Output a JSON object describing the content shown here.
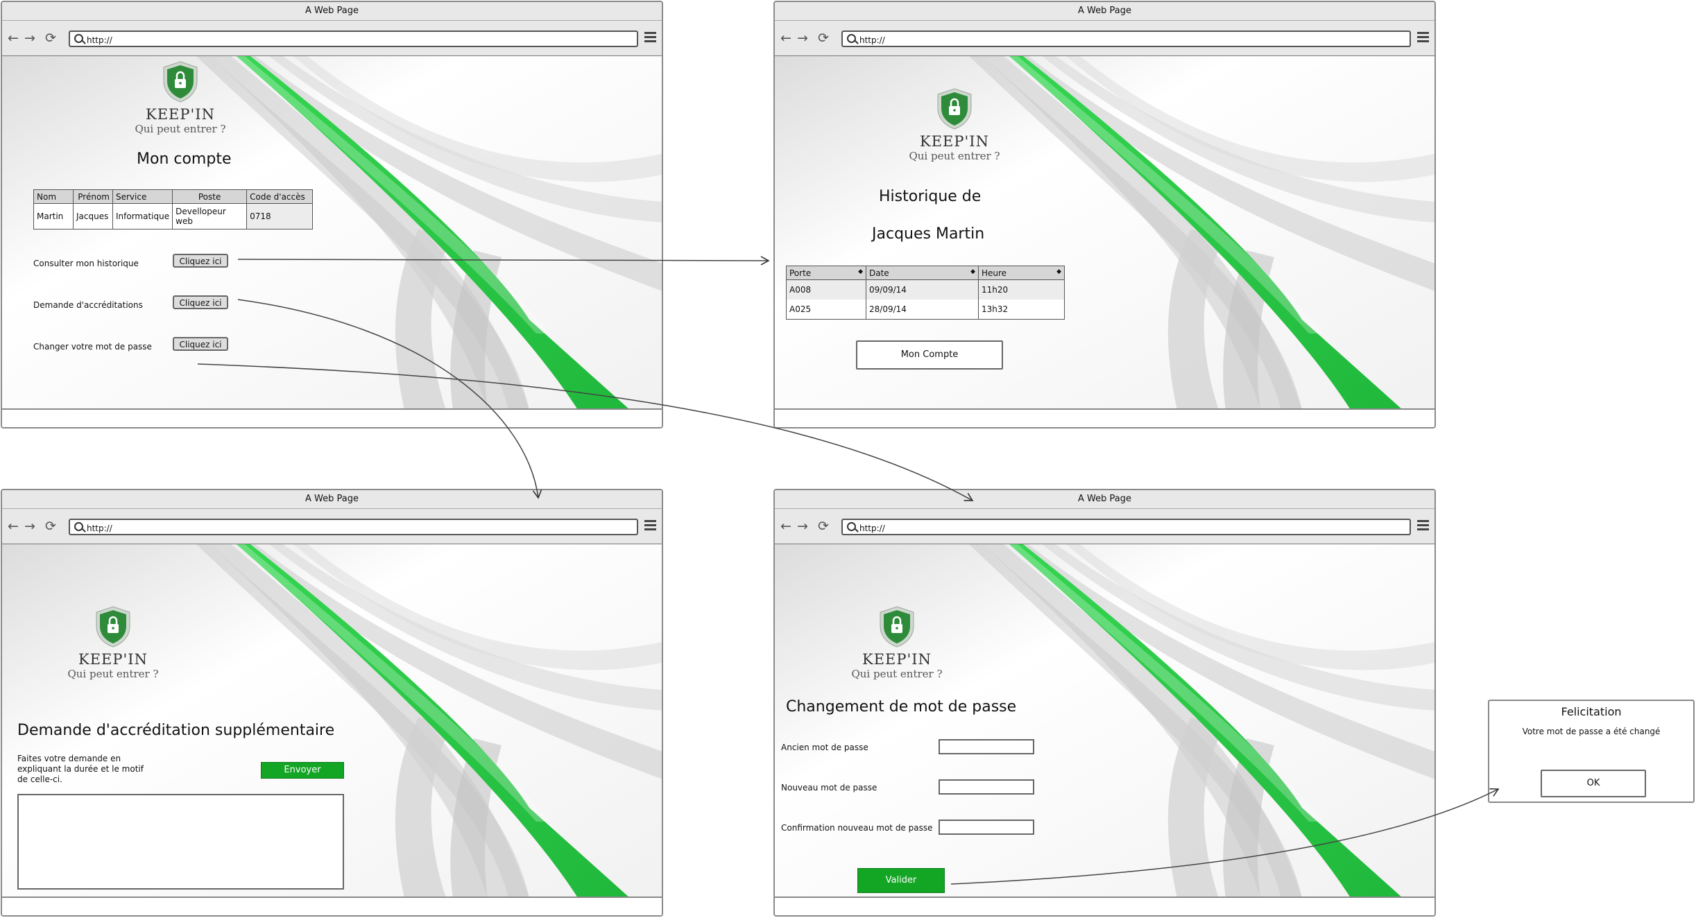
{
  "browser": {
    "title": "A Web Page",
    "url": "http://",
    "nav_back": "←",
    "nav_forward": "→",
    "nav_reload": "⟳"
  },
  "brand": {
    "name": "KEEP'IN",
    "tagline": "Qui peut entrer ?"
  },
  "colors": {
    "accent_green": "#13a524",
    "stripe_green": "#2fd14d",
    "shield_green": "#2e8b3a"
  },
  "mon_compte": {
    "title": "Mon compte",
    "table": {
      "headers": [
        "Nom",
        "Prénom",
        "Service",
        "Poste",
        "Code d'accès"
      ],
      "rows": [
        [
          "Martin",
          "Jacques",
          "Informatique",
          "Devellopeur web",
          "0718"
        ]
      ]
    },
    "actions": [
      {
        "label": "Consulter mon historique",
        "button": "Cliquez ici"
      },
      {
        "label": "Demande d'accréditations",
        "button": "Cliquez ici"
      },
      {
        "label": "Changer votre mot de passe",
        "button": "Cliquez ici"
      }
    ]
  },
  "historique": {
    "title_line1": "Historique de",
    "title_line2": "Jacques Martin",
    "table": {
      "headers": [
        "Porte",
        "Date",
        "Heure"
      ],
      "rows": [
        [
          "A008",
          "09/09/14",
          "11h20"
        ],
        [
          "A025",
          "28/09/14",
          "13h32"
        ]
      ]
    },
    "button": "Mon Compte"
  },
  "accreditation": {
    "title": "Demande d'accréditation supplémentaire",
    "instructions": "Faites votre demande en expliquant la durée et le motif de celle-ci.",
    "send_button": "Envoyer",
    "textarea_value": ""
  },
  "password": {
    "title": "Changement de mot de passe",
    "fields": [
      {
        "label": "Ancien mot de passe",
        "value": ""
      },
      {
        "label": "Nouveau mot de passe",
        "value": ""
      },
      {
        "label": "Confirmation nouveau mot de passe",
        "value": ""
      }
    ],
    "submit": "Valider"
  },
  "dialog": {
    "title": "Felicitation",
    "message": "Votre mot de passe a été changé",
    "ok": "OK"
  }
}
